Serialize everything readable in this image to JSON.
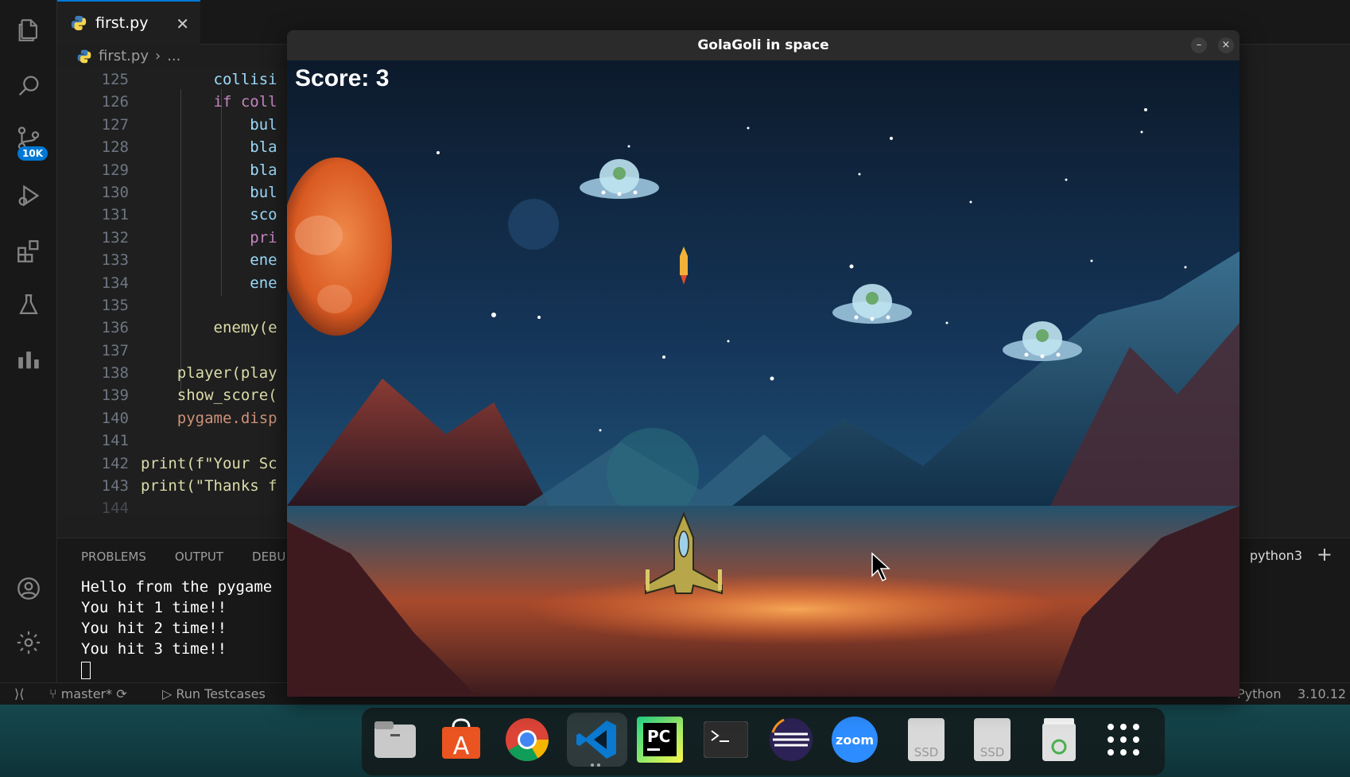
{
  "editor": {
    "tab_label": "first.py",
    "breadcrumb_file": "first.py",
    "breadcrumb_more": "...",
    "line_numbers": [
      "125",
      "126",
      "127",
      "128",
      "129",
      "130",
      "131",
      "132",
      "133",
      "134",
      "135",
      "136",
      "137",
      "138",
      "139",
      "140",
      "141",
      "142",
      "143",
      "144"
    ],
    "code_lines": [
      {
        "text": "        collisi",
        "cls": "plain"
      },
      {
        "text": "        if coll",
        "cls": "kw"
      },
      {
        "text": "            bul",
        "cls": "plain"
      },
      {
        "text": "            bla",
        "cls": "plain"
      },
      {
        "text": "            bla",
        "cls": "plain"
      },
      {
        "text": "            bul",
        "cls": "plain"
      },
      {
        "text": "            sco",
        "cls": "plain"
      },
      {
        "text": "            pri",
        "cls": "kw"
      },
      {
        "text": "            ene",
        "cls": "plain"
      },
      {
        "text": "            ene",
        "cls": "plain"
      },
      {
        "text": "",
        "cls": "plain"
      },
      {
        "text": "        enemy(e",
        "cls": "fn"
      },
      {
        "text": "",
        "cls": "plain"
      },
      {
        "text": "    player(play",
        "cls": "fn"
      },
      {
        "text": "    show_score(",
        "cls": "fn"
      },
      {
        "text": "    pygame.disp",
        "cls": "str"
      },
      {
        "text": "",
        "cls": "plain"
      },
      {
        "text": "print(f\"Your Sc",
        "cls": "fn"
      },
      {
        "text": "print(\"Thanks f",
        "cls": "fn"
      },
      {
        "text": "",
        "cls": "plain"
      }
    ]
  },
  "panel": {
    "tabs": [
      "PROBLEMS",
      "OUTPUT",
      "DEBU"
    ],
    "terminal_lines": [
      "Hello from the pygame",
      "You hit 1 time!!",
      "You hit 2 time!!",
      "You hit 3 time!!"
    ],
    "shell_label": "python3",
    "add_label": "+"
  },
  "statusbar": {
    "branch": "master*",
    "run_testcases": "Run Testcases",
    "language": "Python",
    "version": "3.10.12"
  },
  "activity": {
    "badge": "10K"
  },
  "game": {
    "window_title": "GolaGoli in space",
    "score_text": "Score: 3",
    "minimize": "–",
    "close": "×"
  },
  "dock": {
    "apps": [
      "files-icon",
      "app-center-icon",
      "chrome-icon",
      "vscode-icon",
      "pycharm-icon",
      "terminal-icon",
      "eclipse-icon",
      "zoom-icon",
      "ssd-drive-icon",
      "ssd-drive-icon-2",
      "trash-icon",
      "app-grid-icon"
    ],
    "zoom_label": "zoom",
    "pc_label": "PC",
    "ssd_label": "SSD"
  },
  "colors": {
    "accent": "#0078d4",
    "editor_bg": "#1f1f1f",
    "keyword": "#c586c0",
    "function": "#dcdcaa",
    "string": "#ce9178"
  }
}
